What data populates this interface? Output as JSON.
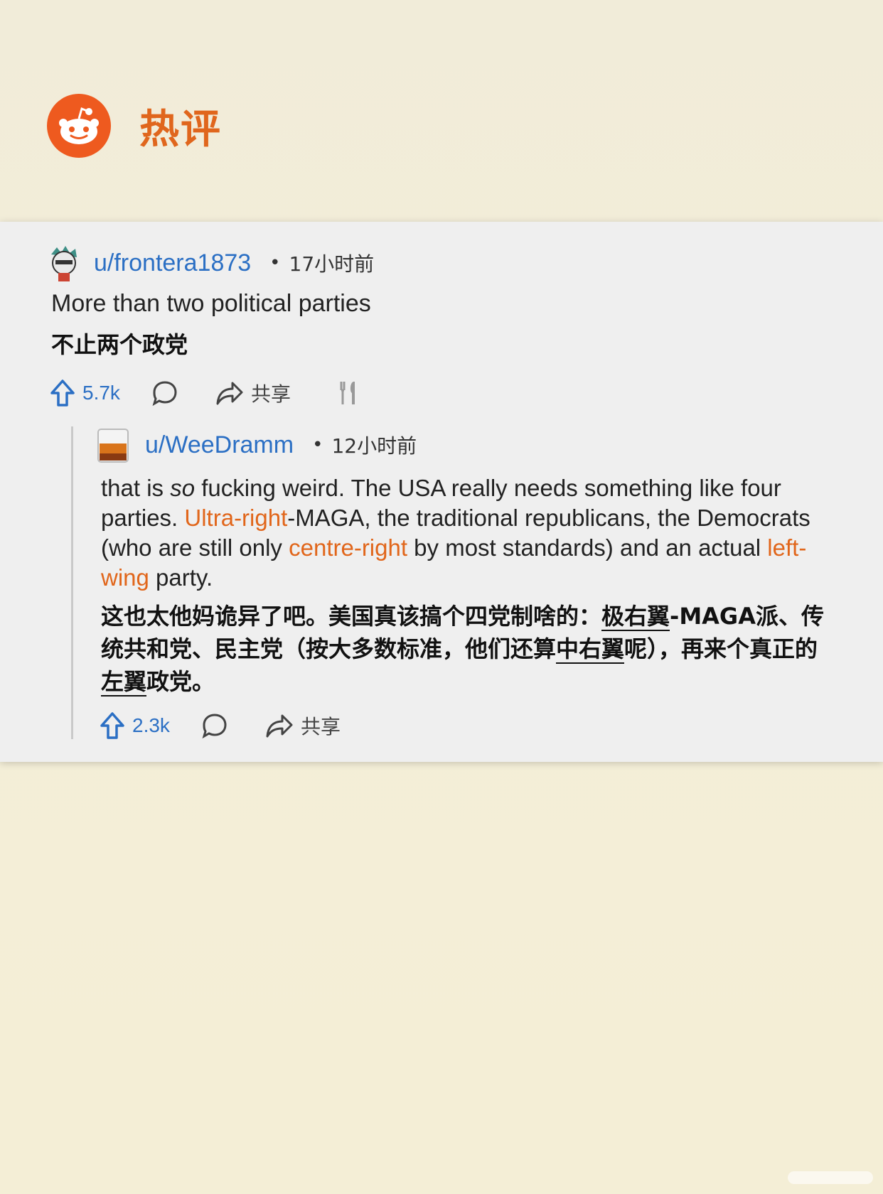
{
  "header": {
    "title": "热评",
    "logo_icon": "reddit-logo"
  },
  "colors": {
    "accent": "#e1661b",
    "link": "#2b6fc4",
    "card": "#efefef"
  },
  "comment1": {
    "username": "u/frontera1873",
    "dot": "•",
    "timestamp": "17小时前",
    "text_en": "More than two political parties",
    "text_zh": "不止两个政党",
    "votes": "5.7k",
    "share_label": "共享"
  },
  "comment2": {
    "username": "u/WeeDramm",
    "dot": "•",
    "timestamp": "12小时前",
    "text_en": {
      "p1": "that is ",
      "p2_italic": "so",
      "p3": " fucking weird. The USA really needs something like four parties. ",
      "hl1": "Ultra-right",
      "p4": "-MAGA, the traditional republicans, the Democrats (who are still only ",
      "hl2": "centre-right",
      "p5": " by most standards) and an actual ",
      "hl3": "left-wing",
      "p6": " party."
    },
    "text_zh": {
      "z1": "这也太他妈诡异了吧。美国真该搞个四党制啥的：",
      "u1": "极右翼",
      "z2": "-MAGA派、传统共和党、民主党（按大多数标准，他们还算",
      "u2": "中右翼",
      "z3": "呢），再来个真正的",
      "u3": "左翼",
      "z4": "政党。"
    },
    "votes": "2.3k",
    "share_label": "共享"
  }
}
